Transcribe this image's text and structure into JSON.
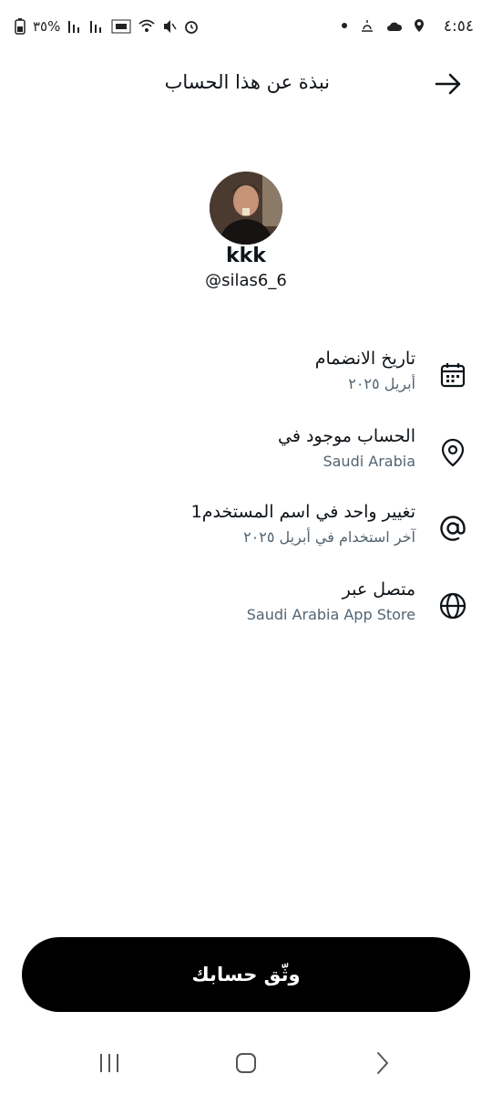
{
  "status_bar": {
    "time": "٤:٥٤",
    "battery_percent": "٣٥%"
  },
  "header": {
    "title": "نبذة عن هذا الحساب"
  },
  "profile": {
    "name": "kkk",
    "handle": "@silas6_6"
  },
  "details": [
    {
      "icon": "calendar-icon",
      "title": "تاريخ الانضمام",
      "subtitle": "أبريل ٢٠٢٥"
    },
    {
      "icon": "location-pin-icon",
      "title": "الحساب موجود في",
      "subtitle": "Saudi Arabia"
    },
    {
      "icon": "at-sign-icon",
      "title": "تغيير واحد في اسم المستخدم1",
      "subtitle": "آخر استخدام في أبريل ٢٠٢٥"
    },
    {
      "icon": "globe-icon",
      "title": "متصل عبر",
      "subtitle": "Saudi Arabia App Store"
    }
  ],
  "cta": {
    "label": "وثّق حسابك"
  },
  "colors": {
    "primary_text": "#0f1419",
    "secondary_text": "#536471",
    "cta_background": "#000000",
    "cta_text": "#ffffff"
  }
}
